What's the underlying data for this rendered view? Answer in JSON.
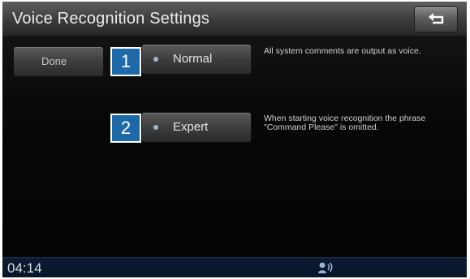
{
  "header": {
    "title": "Voice Recognition Settings",
    "back_icon": "back-arrow-icon"
  },
  "main": {
    "done_label": "Done",
    "modes": [
      {
        "callout": "1",
        "label": "Normal",
        "description": "All system comments are output as voice."
      },
      {
        "callout": "2",
        "label": "Expert",
        "description": "When starting voice recognition the phrase \"Command Please\" is omitted."
      }
    ]
  },
  "statusbar": {
    "time": "04:14",
    "icon": "voice-recognition-status-icon"
  },
  "colors": {
    "callout": "#1e6aa8",
    "statusbar": "#0d1b33",
    "background": "#050505"
  }
}
